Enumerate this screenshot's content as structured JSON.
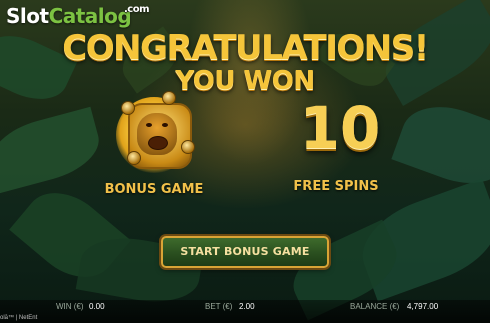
{
  "watermark": {
    "prefix": "Slot",
    "highlight": "Catalog",
    "suffix": ".com"
  },
  "heading": {
    "line1": "CONGRATULATIONS!",
    "line2": "YOU WON"
  },
  "bonus": {
    "label": "BONUS GAME"
  },
  "free_spins": {
    "count": "10",
    "label": "FREE SPINS"
  },
  "start_button": {
    "label": "START BONUS GAME"
  },
  "status_bar": {
    "win_label": "WIN (€)",
    "win_value": "0.00",
    "bet_label": "BET (€)",
    "bet_value": "2.00",
    "balance_label": "BALANCE (€)",
    "balance_value": "4,797.00"
  },
  "footer": {
    "text": "olā™ | NetEnt"
  },
  "colors": {
    "gold": "#f5c53a",
    "button_bg": "#2a4f1f",
    "button_border": "#d9a436",
    "watermark_green": "#7cc242"
  }
}
